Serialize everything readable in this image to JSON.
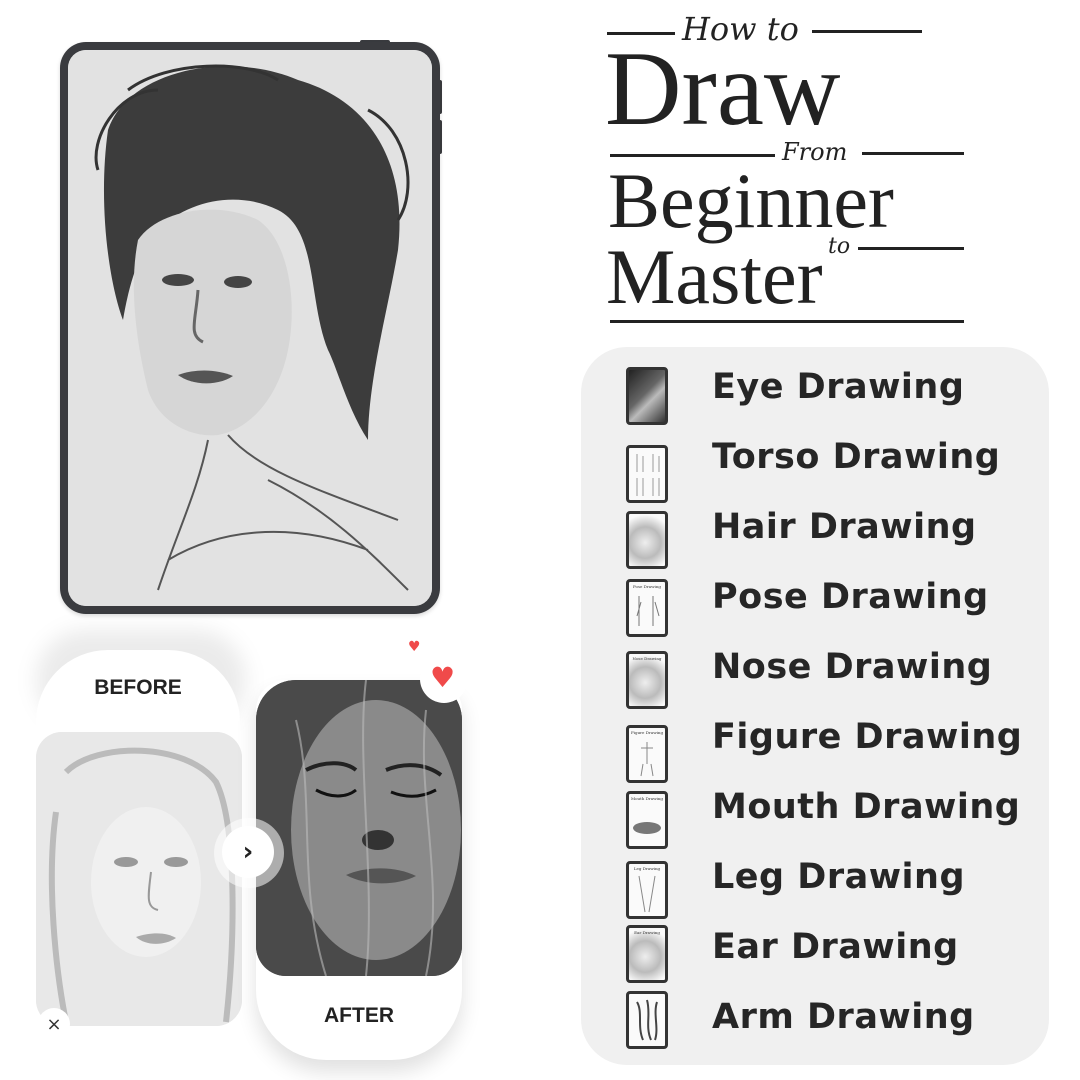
{
  "title": {
    "line1_script": "How to",
    "line2": "Draw",
    "line3_script": "From",
    "line4": "Beginner",
    "line5_script": "to",
    "line6": "Master"
  },
  "topics": [
    {
      "label": "Eye Drawing",
      "icon": "eye-drawing-thumbnail",
      "thumb_caption": ""
    },
    {
      "label": "Torso Drawing",
      "icon": "torso-drawing-thumbnail",
      "thumb_caption": ""
    },
    {
      "label": "Hair Drawing",
      "icon": "hair-drawing-thumbnail",
      "thumb_caption": ""
    },
    {
      "label": "Pose Drawing",
      "icon": "pose-drawing-thumbnail",
      "thumb_caption": "Pose Drawing"
    },
    {
      "label": "Nose Drawing",
      "icon": "nose-drawing-thumbnail",
      "thumb_caption": "Nose Drawing"
    },
    {
      "label": "Figure Drawing",
      "icon": "figure-drawing-thumbnail",
      "thumb_caption": "Figure Drawing"
    },
    {
      "label": "Mouth Drawing",
      "icon": "mouth-drawing-thumbnail",
      "thumb_caption": "Mouth Drawing"
    },
    {
      "label": "Leg Drawing",
      "icon": "leg-drawing-thumbnail",
      "thumb_caption": "Leg Drawing"
    },
    {
      "label": "Ear Drawing",
      "icon": "ear-drawing-thumbnail",
      "thumb_caption": "Ear Drawing"
    },
    {
      "label": "Arm Drawing",
      "icon": "arm-drawing-thumbnail",
      "thumb_caption": ""
    }
  ],
  "comparison": {
    "before_label": "BEFORE",
    "after_label": "AFTER",
    "next_icon": "›",
    "close_icon": "×",
    "heart_icon": "♥"
  },
  "colors": {
    "ink": "#222222",
    "panel_bg": "#f0f0f0",
    "tablet_frame": "#3a3b3f",
    "heart": "#f04a4a"
  }
}
